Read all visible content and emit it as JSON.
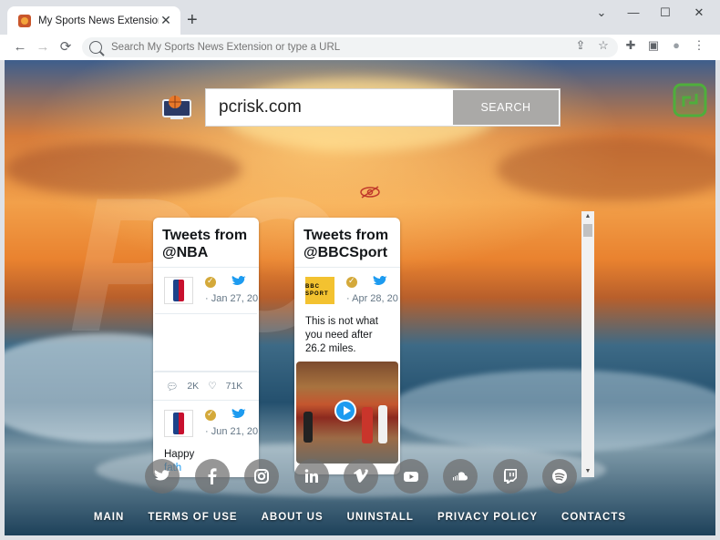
{
  "browser": {
    "tab_title": "My Sports News Extension",
    "tab_close": "✕",
    "new_tab": "+",
    "window_controls": {
      "minimize": "—",
      "maximize": "☐",
      "close": "✕",
      "menu": "⌄"
    },
    "nav": {
      "back": "←",
      "forward": "→",
      "reload": "⟳"
    },
    "omnibox_placeholder": "Search My Sports News Extension or type a URL",
    "toolbar_icons": [
      "share-icon",
      "star-icon",
      "extensions-icon",
      "sidepanel-icon",
      "profile-icon",
      "kebab-menu-icon"
    ],
    "toolbar_glyphs": {
      "share": "⇪",
      "star": "☆",
      "extensions": "✚",
      "sidepanel": "▣",
      "profile": "●",
      "menu": "⋮"
    }
  },
  "search": {
    "query": "pcrisk.com",
    "button_label": "SEARCH"
  },
  "widgets": {
    "nba": {
      "header": "Tweets from @NBA",
      "tweet1_date": "· Jan 27, 20",
      "replies": "2K",
      "likes": "71K",
      "tweet2_date": "· Jun 21, 20",
      "tweet2_text": "Happy",
      "tweet2_text2": "fath"
    },
    "bbc": {
      "header": "Tweets from @BBCSport",
      "avatar_text": "BBC SPORT",
      "tweet_date": "· Apr 28, 20",
      "tweet_text": "This is not what you need after 26.2 miles."
    }
  },
  "social": [
    "twitter-icon",
    "facebook-icon",
    "instagram-icon",
    "linkedin-icon",
    "vimeo-icon",
    "youtube-icon",
    "soundcloud-icon",
    "twitch-icon",
    "spotify-icon"
  ],
  "footer": {
    "links": [
      "MAIN",
      "TERMS OF USE",
      "ABOUT US",
      "UNINSTALL",
      "PRIVACY POLICY",
      "CONTACTS"
    ]
  },
  "colors": {
    "search_button": "#aaa9a7",
    "twitter_blue": "#1d9bf0",
    "share_green": "#4fae3c"
  }
}
